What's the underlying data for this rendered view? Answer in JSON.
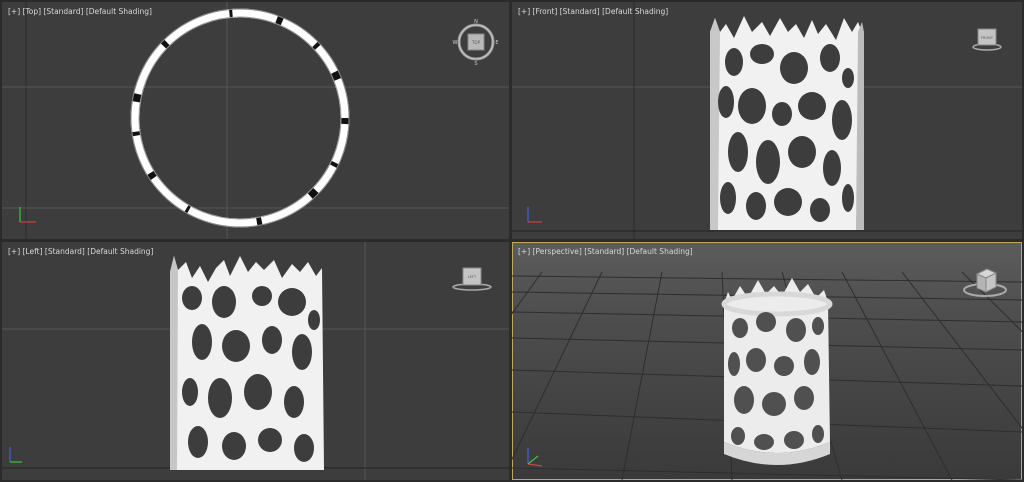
{
  "viewports": {
    "top": {
      "label_plus": "[+]",
      "label_view": "[Top]",
      "label_mode": "[Standard]",
      "label_shading": "[Default Shading]"
    },
    "front": {
      "label_plus": "[+]",
      "label_view": "[Front]",
      "label_mode": "[Standard]",
      "label_shading": "[Default Shading]",
      "cube_face": "FRONT"
    },
    "left": {
      "label_plus": "[+]",
      "label_view": "[Left]",
      "label_mode": "[Standard]",
      "label_shading": "[Default Shading]",
      "cube_face": "LEFT"
    },
    "persp": {
      "label_plus": "[+]",
      "label_view": "[Perspective]",
      "label_mode": "[Standard]",
      "label_shading": "[Default Shading]"
    }
  },
  "compass": {
    "n": "N",
    "s": "S",
    "e": "E",
    "w": "W",
    "cube_face": "TOP"
  },
  "colors": {
    "viewport_bg": "#3d3d3d",
    "active_border": "#c2a95a",
    "grid": "#555555",
    "axis_x": "#d04040",
    "axis_y": "#40c040",
    "axis_z": "#4060e0"
  }
}
